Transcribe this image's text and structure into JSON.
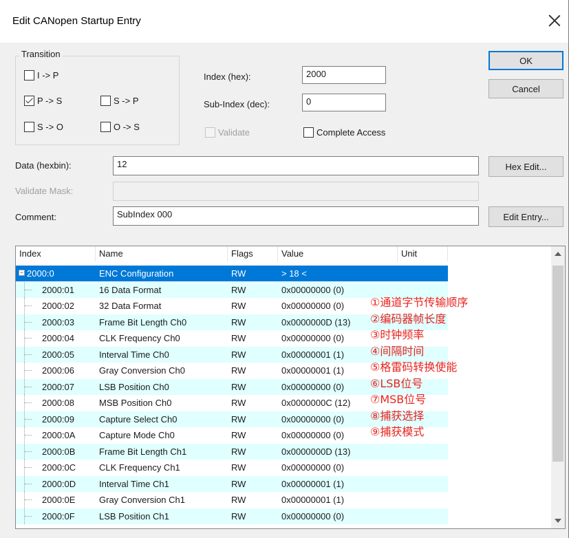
{
  "window": {
    "title": "Edit CANopen Startup Entry"
  },
  "transition": {
    "legend": "Transition",
    "ip": {
      "label": "I -> P",
      "checked": false
    },
    "ps": {
      "label": "P -> S",
      "checked": true
    },
    "sp": {
      "label": "S -> P",
      "checked": false
    },
    "so": {
      "label": "S -> O",
      "checked": false
    },
    "os": {
      "label": "O -> S",
      "checked": false
    }
  },
  "fields": {
    "index_label": "Index (hex):",
    "index_value": "2000",
    "subindex_label": "Sub-Index (dec):",
    "subindex_value": "0",
    "validate_label": "Validate",
    "complete_access_label": "Complete Access",
    "data_label": "Data (hexbin):",
    "data_value": "12",
    "validate_mask_label": "Validate Mask:",
    "validate_mask_value": "",
    "comment_label": "Comment:",
    "comment_value": "SubIndex 000"
  },
  "buttons": {
    "ok": "OK",
    "cancel": "Cancel",
    "hex_edit": "Hex Edit...",
    "edit_entry": "Edit Entry..."
  },
  "table": {
    "headers": [
      "Index",
      "Name",
      "Flags",
      "Value",
      "Unit"
    ],
    "rows": [
      {
        "index": "2000:0",
        "name": "ENC Configuration",
        "flags": "RW",
        "value": "> 18 <"
      },
      {
        "index": "2000:01",
        "name": "16 Data Format",
        "flags": "RW",
        "value": "0x00000000 (0)"
      },
      {
        "index": "2000:02",
        "name": "32 Data Format",
        "flags": "RW",
        "value": "0x00000000 (0)"
      },
      {
        "index": "2000:03",
        "name": "Frame Bit Length Ch0",
        "flags": "RW",
        "value": "0x0000000D (13)"
      },
      {
        "index": "2000:04",
        "name": "CLK Frequency Ch0",
        "flags": "RW",
        "value": "0x00000000 (0)"
      },
      {
        "index": "2000:05",
        "name": "Interval Time Ch0",
        "flags": "RW",
        "value": "0x00000001 (1)"
      },
      {
        "index": "2000:06",
        "name": "Gray Conversion Ch0",
        "flags": "RW",
        "value": "0x00000001 (1)"
      },
      {
        "index": "2000:07",
        "name": "LSB Position Ch0",
        "flags": "RW",
        "value": "0x00000000 (0)"
      },
      {
        "index": "2000:08",
        "name": "MSB Position Ch0",
        "flags": "RW",
        "value": "0x0000000C (12)"
      },
      {
        "index": "2000:09",
        "name": "Capture Select Ch0",
        "flags": "RW",
        "value": "0x00000000 (0)"
      },
      {
        "index": "2000:0A",
        "name": "Capture Mode Ch0",
        "flags": "RW",
        "value": "0x00000000 (0)"
      },
      {
        "index": "2000:0B",
        "name": "Frame Bit Length Ch1",
        "flags": "RW",
        "value": "0x0000000D (13)"
      },
      {
        "index": "2000:0C",
        "name": "CLK Frequency Ch1",
        "flags": "RW",
        "value": "0x00000000 (0)"
      },
      {
        "index": "2000:0D",
        "name": "Interval Time Ch1",
        "flags": "RW",
        "value": "0x00000001 (1)"
      },
      {
        "index": "2000:0E",
        "name": "Gray Conversion Ch1",
        "flags": "RW",
        "value": "0x00000001 (1)"
      },
      {
        "index": "2000:0F",
        "name": "LSB Position Ch1",
        "flags": "RW",
        "value": "0x00000000 (0)"
      }
    ]
  },
  "annotations": [
    "①通道字节传输顺序",
    "②编码器帧长度",
    "③时钟频率",
    "④间隔时间",
    "⑤格雷码转换使能",
    "⑥LSB位号",
    "⑦MSB位号",
    "⑧捕获选择",
    "⑨捕获模式"
  ],
  "colors": {
    "selection": "#0078d7",
    "alt_row": "#e0ffff",
    "annotation": "#e8241f"
  }
}
